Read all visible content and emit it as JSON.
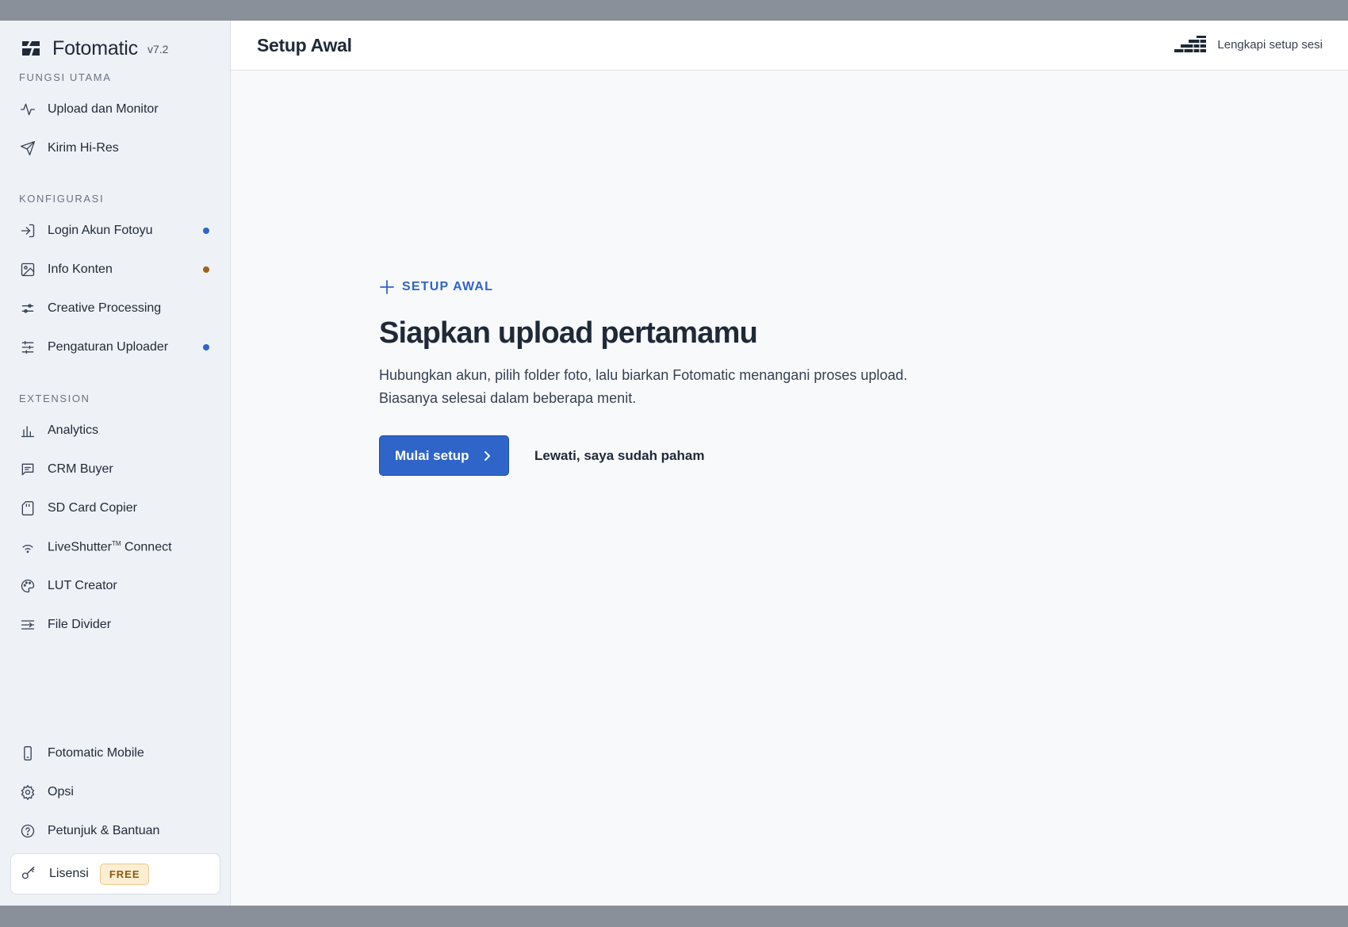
{
  "app": {
    "name": "Fotomatic",
    "version": "v7.2"
  },
  "sidebar": {
    "sections": {
      "main": "FUNGSI UTAMA",
      "config": "KONFIGURASI",
      "extension": "EXTENSION"
    },
    "main_items": [
      {
        "label": "Upload dan Monitor",
        "icon": "activity-icon"
      },
      {
        "label": "Kirim Hi-Res",
        "icon": "send-icon"
      }
    ],
    "config_items": [
      {
        "label": "Login Akun Fotoyu",
        "icon": "login-icon",
        "indicator": "#2f65c8"
      },
      {
        "label": "Info Konten",
        "icon": "image-icon",
        "indicator": "#a0621a"
      },
      {
        "label": "Creative Processing",
        "icon": "adjust-icon"
      },
      {
        "label": "Pengaturan Uploader",
        "icon": "sliders-icon",
        "indicator": "#2f65c8"
      }
    ],
    "extension_items": [
      {
        "label": "Analytics",
        "icon": "bar-chart-icon"
      },
      {
        "label": "CRM Buyer",
        "icon": "message-icon"
      },
      {
        "label": "SD Card Copier",
        "icon": "sd-card-icon"
      },
      {
        "label": "LiveShutter",
        "tm": "TM",
        "label_suffix": " Connect",
        "icon": "wifi-icon"
      },
      {
        "label": "LUT Creator",
        "icon": "palette-icon"
      },
      {
        "label": "File Divider",
        "icon": "divider-icon"
      }
    ],
    "bottom_items": [
      {
        "label": "Fotomatic Mobile",
        "icon": "phone-icon"
      },
      {
        "label": "Opsi",
        "icon": "gear-icon"
      },
      {
        "label": "Petunjuk & Bantuan",
        "icon": "help-icon"
      }
    ],
    "license": {
      "label": "Lisensi",
      "badge": "FREE",
      "icon": "key-icon"
    }
  },
  "topbar": {
    "title": "Setup Awal",
    "session_text": "Lengkapi setup sesi",
    "session_icon": "stairs-icon"
  },
  "hero": {
    "eyebrow": "SETUP AWAL",
    "heading": "Siapkan upload pertamamu",
    "body": "Hubungkan akun, pilih folder foto, lalu biarkan Fotomatic menangani proses upload. Biasanya selesai dalam beberapa menit.",
    "primary_button": "Mulai setup",
    "secondary_button": "Lewati, saya sudah paham"
  },
  "colors": {
    "accent": "#2f65c8",
    "indicator_blue": "#2f65c8",
    "indicator_orange": "#a0621a",
    "badge_bg": "#fbeed3"
  }
}
